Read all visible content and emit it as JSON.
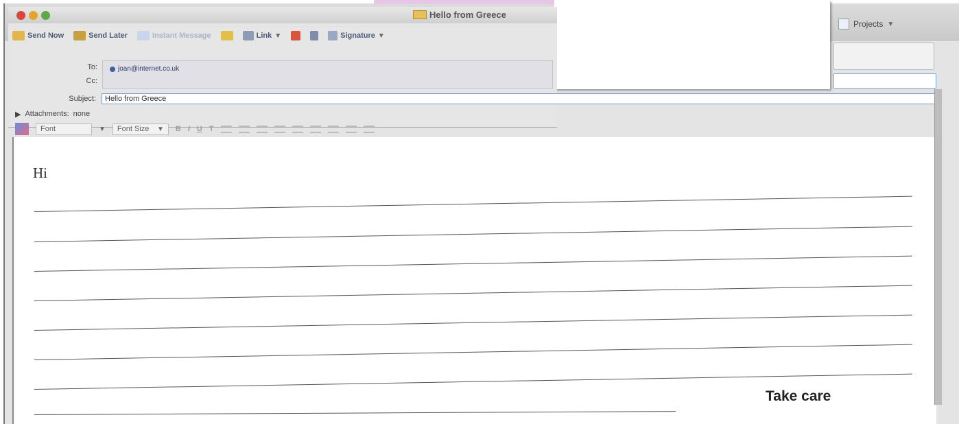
{
  "compose_window": {
    "title": "Hello from Greece",
    "toolbar": {
      "send_now": "Send Now",
      "send_later": "Send Later",
      "instant_message": "Instant Message",
      "link": "Link",
      "signature": "Signature"
    },
    "headers": {
      "to_label": "To:",
      "to_value": "joan@internet.co.uk",
      "cc_label": "Cc:",
      "subject_label": "Subject:",
      "subject_value": "Hello from Greece",
      "attachments_label": "Attachments:",
      "attachments_value": "none"
    },
    "format_bar": {
      "font": "Font",
      "font_size": "Font Size",
      "bold": "B",
      "italic": "I",
      "underline": "U",
      "text_style": "T"
    }
  },
  "background_window": {
    "projects_label": "Projects"
  },
  "letter": {
    "greeting": "Hi",
    "signoff": "Take care",
    "ruled_line_count": 8
  },
  "colors": {
    "subject_border": "#7a9ad0",
    "close_button": "#d8463c",
    "minimize_button": "#e3a52b",
    "zoom_button": "#5fa84a"
  }
}
